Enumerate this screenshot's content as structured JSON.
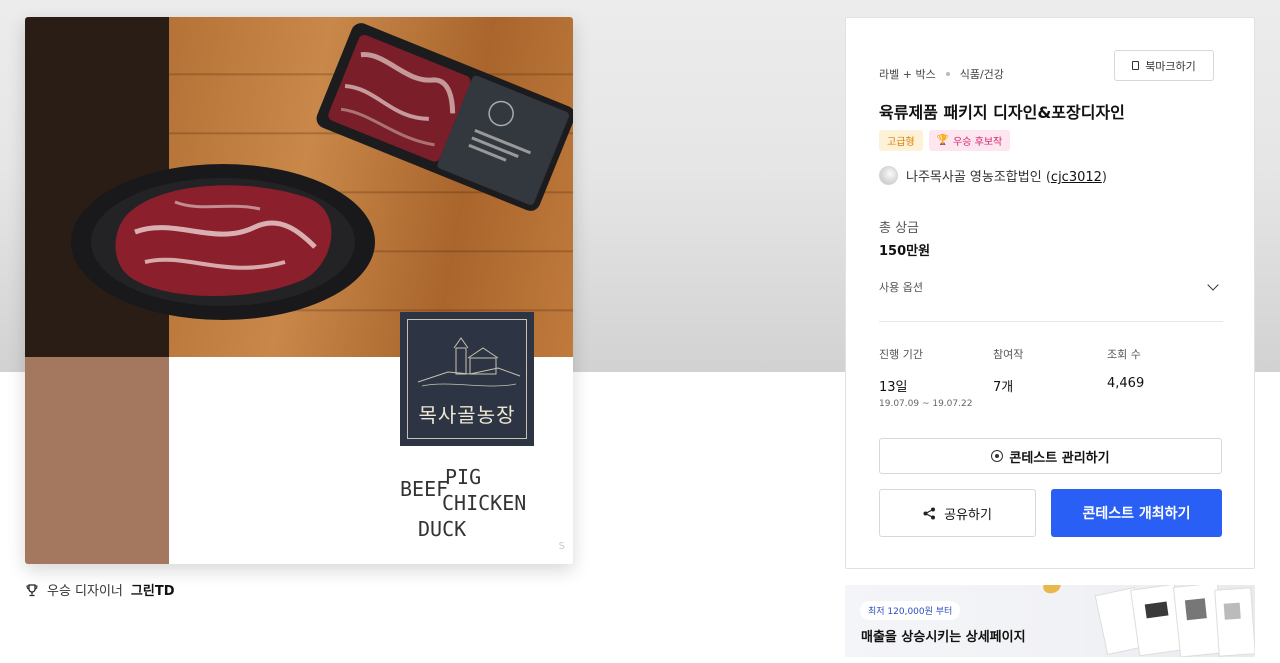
{
  "gallery": {
    "brand_logo_text": "목사골농장",
    "meat_words": [
      "BEEF",
      "PIG",
      "CHICKEN",
      "DUCK"
    ],
    "watermark": "S"
  },
  "award": {
    "label": "우승 디자이너",
    "designer": "그린TD"
  },
  "panel": {
    "breadcrumb": [
      "라벨 + 박스",
      "식품/건강"
    ],
    "bookmark_label": "북마크하기",
    "title": "육류제품 패키지 디자인&포장디자인",
    "badges": {
      "grade": "고급형",
      "winner": "우승 후보작",
      "grade_color": "#e07b00",
      "winner_color": "#d6246e"
    },
    "owner": {
      "name": "나주목사골 영농조합법인",
      "id": "cjc3012"
    },
    "prize": {
      "label": "총 상금",
      "value": "150만원"
    },
    "options_label": "사용 옵션",
    "stats": {
      "period_label": "진행 기간",
      "period_value": "13일",
      "period_range": "19.07.09 ~ 19.07.22",
      "entries_label": "참여작",
      "entries_value": "7개",
      "views_label": "조회 수",
      "views_value": "4,469"
    },
    "manage_label": "콘테스트 관리하기",
    "share_label": "공유하기",
    "host_label": "콘테스트 개최하기",
    "accent_color": "#2a5ff5"
  },
  "banner": {
    "pill": "최저 120,000원 부터",
    "title": "매출을 상승시키는 상세페이지"
  }
}
